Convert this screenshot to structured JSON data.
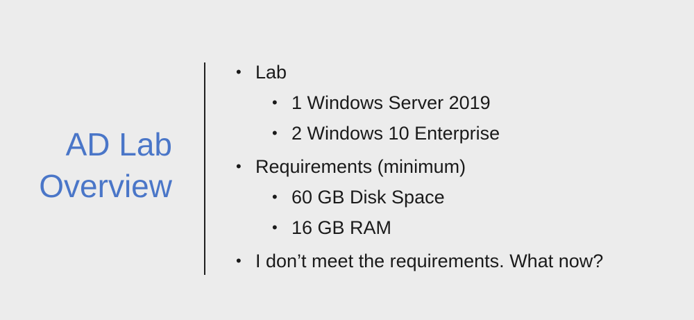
{
  "slide": {
    "title_line1": "AD Lab",
    "title_line2": "Overview",
    "bullet_symbol": "•",
    "items": [
      {
        "level": 1,
        "text": "Lab"
      },
      {
        "level": 2,
        "text": "1 Windows Server 2019"
      },
      {
        "level": 2,
        "text": "2 Windows 10 Enterprise"
      },
      {
        "level": 1,
        "text": "Requirements (minimum)"
      },
      {
        "level": 2,
        "text": "60 GB Disk Space"
      },
      {
        "level": 2,
        "text": "16 GB RAM"
      },
      {
        "level": 1,
        "text": "I don’t meet the requirements. What now?"
      }
    ]
  },
  "colors": {
    "background": "#ececec",
    "title": "#4a76c8",
    "text": "#1a1a1a",
    "divider": "#1e1e1e"
  }
}
